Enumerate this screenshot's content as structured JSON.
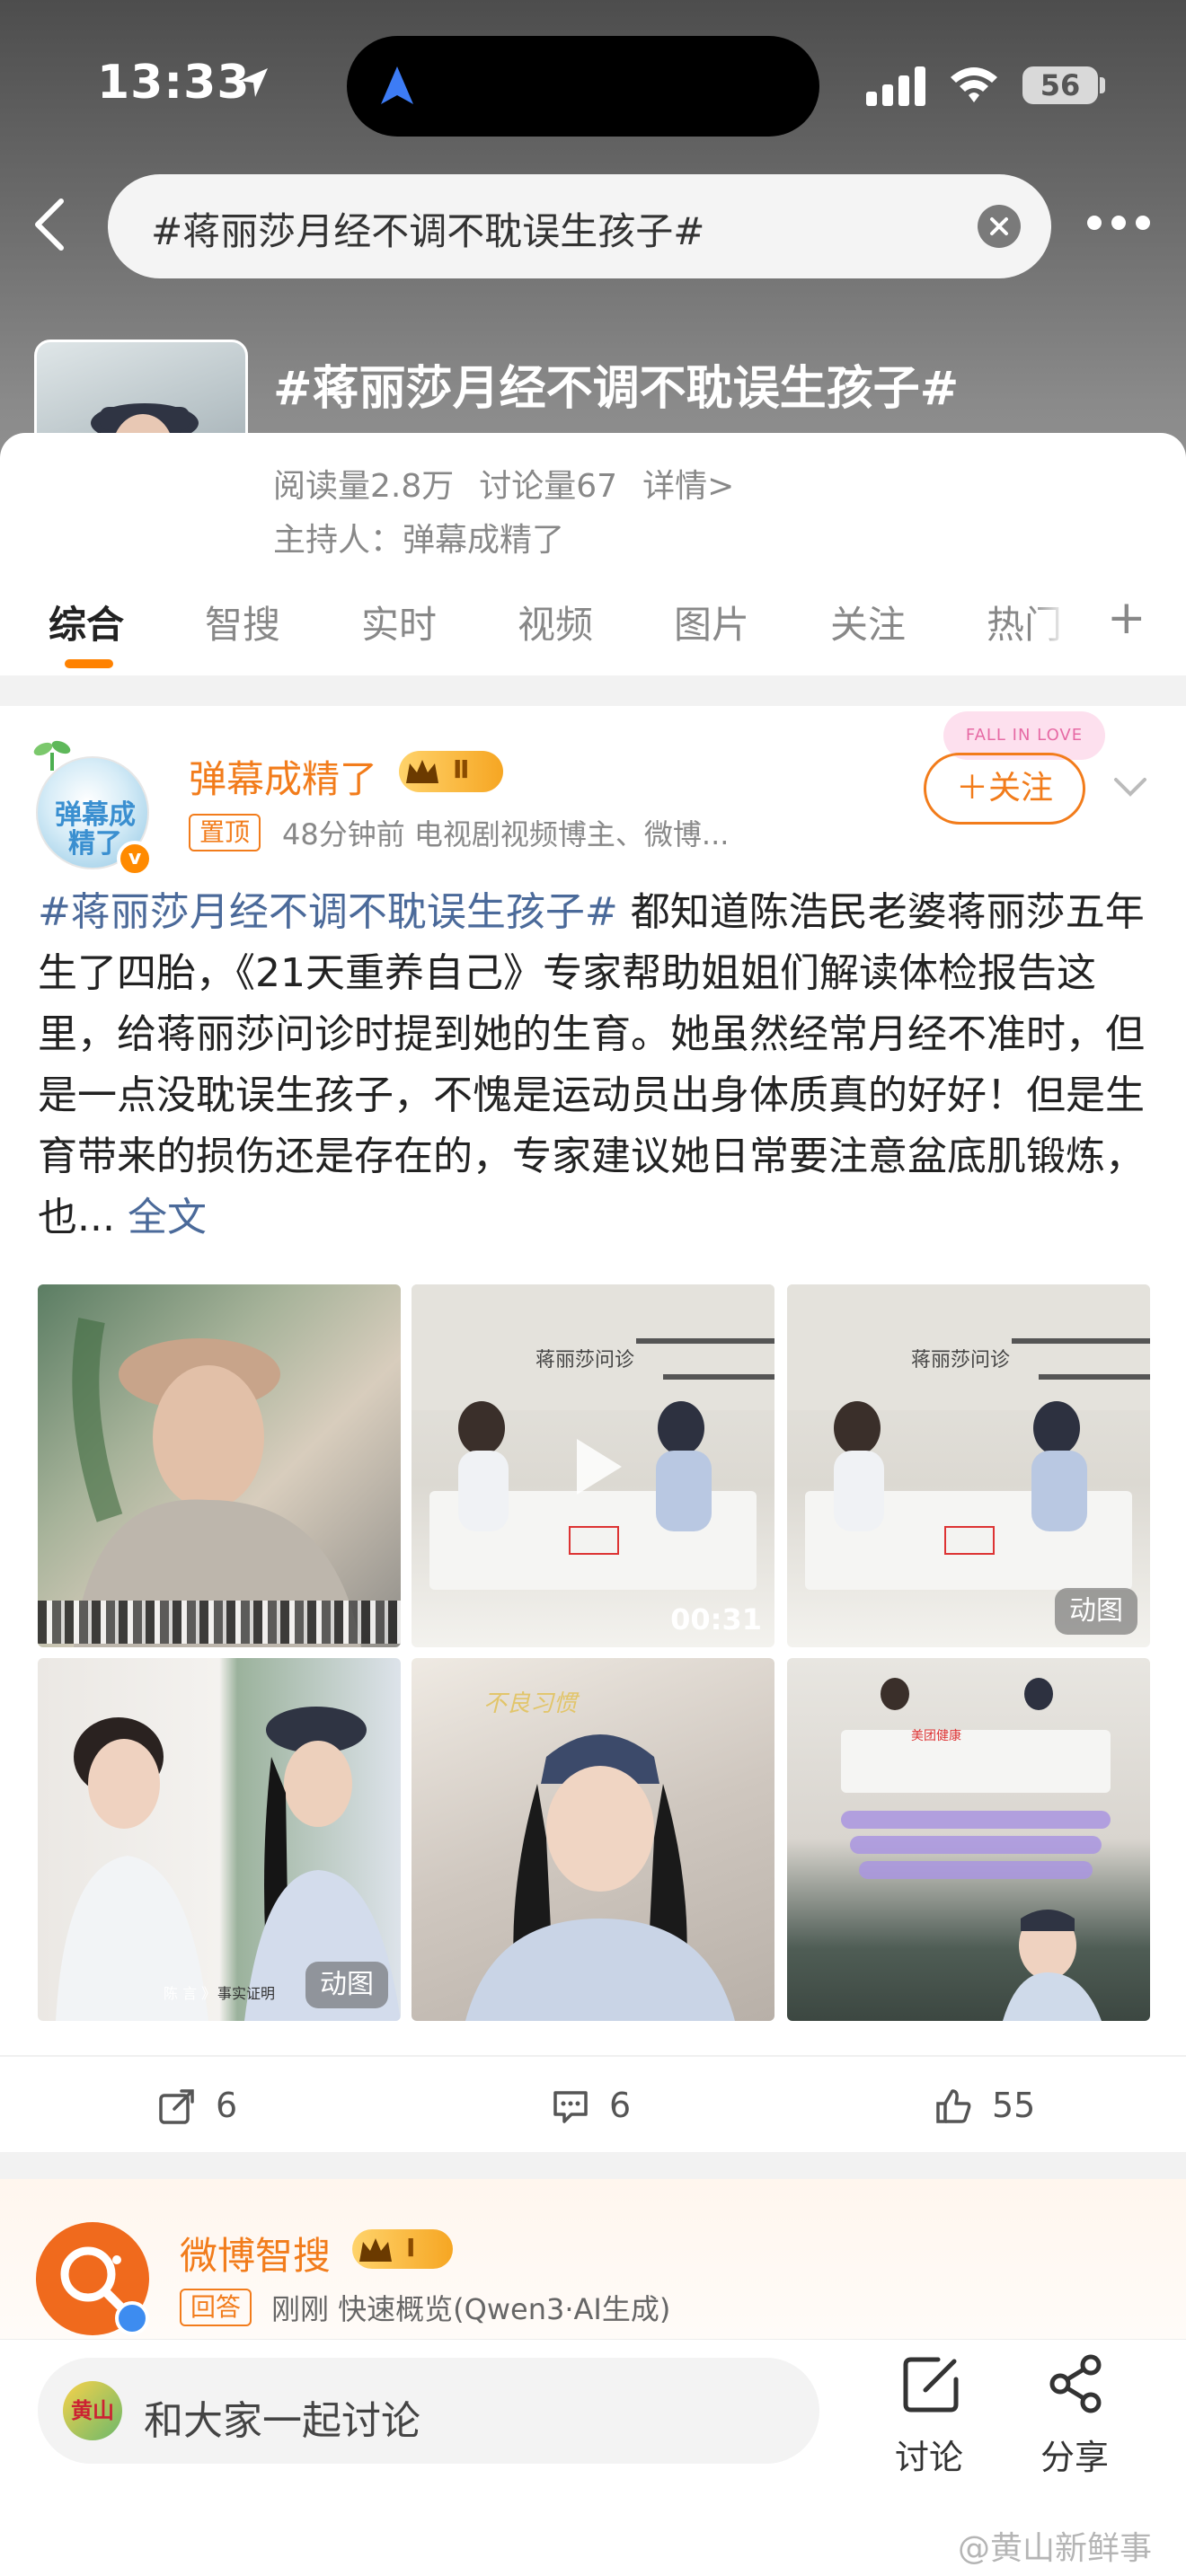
{
  "status_bar": {
    "time": "13:33",
    "battery": "56"
  },
  "header": {
    "search_text": "#蒋丽莎月经不调不耽误生孩子#",
    "topic_title": "#蒋丽莎月经不调不耽误生孩子#"
  },
  "topic": {
    "reads": "阅读量2.8万",
    "discussions": "讨论量67",
    "details": "详情>",
    "host": "主持人：弹幕成精了"
  },
  "tabs": [
    "综合",
    "智搜",
    "实时",
    "视频",
    "图片",
    "关注",
    "热门"
  ],
  "post": {
    "author": "弹幕成精了",
    "avatar_text": "弹幕成精了",
    "level": "Ⅱ",
    "pin_label": "置顶",
    "meta": "48分钟前   电视剧视频博主、微博...",
    "sticker": "FALL IN LOVE",
    "follow_label": "＋关注",
    "hashtag": "#蒋丽莎月经不调不耽误生孩子#",
    "body": " 都知道陈浩民老婆蒋丽莎五年生了四胎，《21天重养自己》专家帮助姐姐们解读体检报告这里，给蒋丽莎问诊时提到她的生育。她虽然经常月经不准时，但是一点没耽误生孩子，不愧是运动员出身体质真的好好！但是生育带来的损伤还是存在的，专家建议她日常要注意盆底肌锻炼，也...",
    "full_text": "全文",
    "images": {
      "video_duration": "00:31",
      "gif_label": "动图",
      "sign_text": "蒋丽莎问诊",
      "caption_tag": "陈 言 》",
      "caption_tag2": "事实证明",
      "img5_caption": "不良习惯",
      "table_sign": "美团健康"
    },
    "actions": {
      "reposts": "6",
      "comments": "6",
      "likes": "55"
    }
  },
  "card2": {
    "name": "微博智搜",
    "level": "Ⅰ",
    "tag": "回答",
    "meta": "刚刚  快速概览(Qwen3·AI生成)"
  },
  "bottom_bar": {
    "avatar_text": "黄山",
    "placeholder": "和大家一起讨论",
    "discuss_label": "讨论",
    "share_label": "分享"
  },
  "watermark": "@黄山新鲜事"
}
